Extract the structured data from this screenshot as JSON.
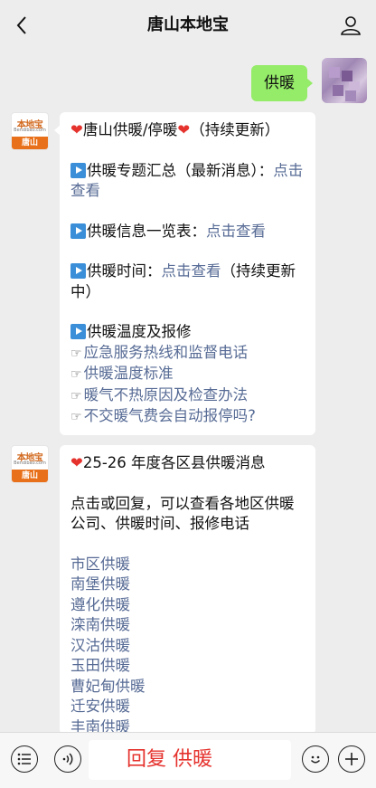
{
  "header": {
    "title": "唐山本地宝"
  },
  "sent_message": {
    "text": "供暖"
  },
  "bot": {
    "logo_text": "本地宝",
    "logo_sub": "Bendibao.com",
    "logo_city": "唐山"
  },
  "message1": {
    "title": "唐山供暖/停暖",
    "title_suffix": "（持续更新）",
    "item1_text": "供暖专题汇总（最新消息）：",
    "item1_link": "点击查看",
    "item2_text": "供暖信息一览表：",
    "item2_link": "点击查看",
    "item3_text": "供暖时间：",
    "item3_link": "点击查看",
    "item3_suffix": "（持续更新中）",
    "item4_text": "供暖温度及报修",
    "sub_links": [
      "应急服务热线和监督电话",
      "供暖温度标准",
      "暖气不热原因及检查办法",
      "不交暖气费会自动报停吗?"
    ]
  },
  "message2": {
    "title": "25-26 年度各区县供暖消息",
    "description": "点击或回复，可以查看各地区供暖公司、供暖时间、报修电话",
    "districts": [
      "市区供暖",
      "南堡供暖",
      "遵化供暖",
      "滦南供暖",
      "汉沽供暖",
      "玉田供暖",
      "曹妃甸供暖",
      "迁安供暖",
      "丰南供暖"
    ]
  },
  "input": {
    "text": "回复 供暖"
  }
}
